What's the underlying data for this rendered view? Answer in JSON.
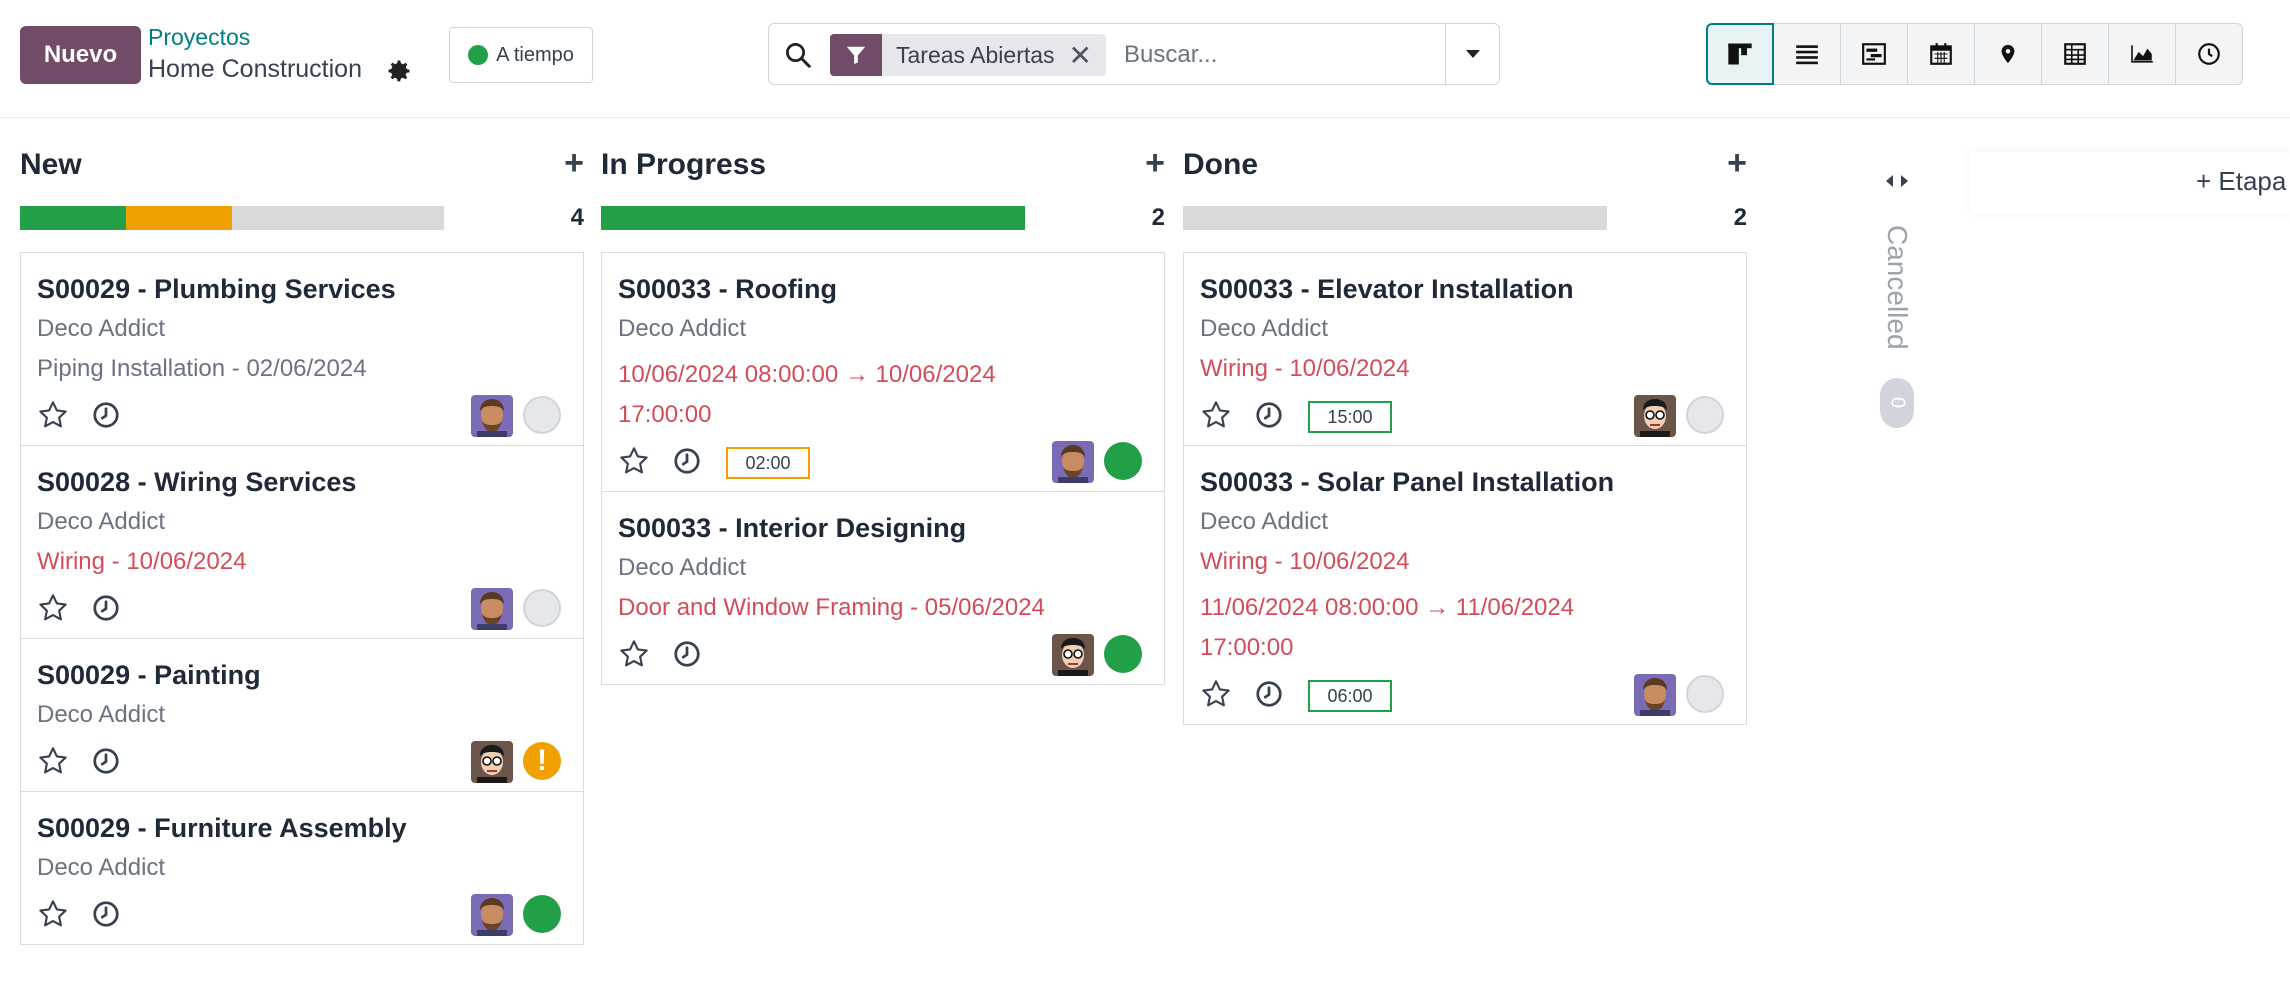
{
  "header": {
    "new_button": "Nuevo",
    "breadcrumb_link": "Proyectos",
    "project_name": "Home Construction",
    "status_label": "A tiempo"
  },
  "search": {
    "facet_label": "Tareas Abiertas",
    "placeholder": "Buscar..."
  },
  "views": [
    "kanban-icon",
    "list-icon",
    "gantt-icon",
    "calendar-icon",
    "map-icon",
    "pivot-icon",
    "graph-icon",
    "activity-icon"
  ],
  "columns": [
    {
      "name": "New",
      "count": "4",
      "progress": {
        "green": 0.25,
        "orange": 0.25
      },
      "cards": [
        {
          "title": "S00029 - Plumbing Services",
          "customer": "Deco Addict",
          "lines": [
            {
              "text": "Piping Installation - 02/06/2024",
              "red": false
            }
          ],
          "time": "",
          "avatar": "man",
          "state": "grey"
        },
        {
          "title": "S00028 - Wiring Services",
          "customer": "Deco Addict",
          "lines": [
            {
              "text": "Wiring - 10/06/2024",
              "red": true
            }
          ],
          "time": "",
          "avatar": "man",
          "state": "grey"
        },
        {
          "title": "S00029 - Painting",
          "customer": "Deco Addict",
          "lines": [],
          "time": "",
          "avatar": "glasses",
          "state": "orange"
        },
        {
          "title": "S00029 - Furniture Assembly",
          "customer": "Deco Addict",
          "lines": [],
          "time": "",
          "avatar": "man",
          "state": "green"
        }
      ]
    },
    {
      "name": "In Progress",
      "count": "2",
      "progress": {
        "green": 1.0,
        "orange": 0
      },
      "cards": [
        {
          "title": "S00033 - Roofing",
          "customer": "Deco Addict",
          "lines": [
            {
              "text": "10/06/2024 08:00:00 → 10/06/2024",
              "red": true
            },
            {
              "text": "17:00:00",
              "red": true
            }
          ],
          "time": "02:00",
          "time_color": "orange",
          "avatar": "man",
          "state": "green"
        },
        {
          "title": "S00033 - Interior Designing",
          "customer": "Deco Addict",
          "lines": [
            {
              "text": "Door and Window Framing - 05/06/2024",
              "red": true
            }
          ],
          "time": "",
          "avatar": "glasses",
          "state": "green"
        }
      ]
    },
    {
      "name": "Done",
      "count": "2",
      "progress": {
        "green": 0,
        "orange": 0
      },
      "cards": [
        {
          "title": "S00033 - Elevator Installation",
          "customer": "Deco Addict",
          "lines": [
            {
              "text": "Wiring - 10/06/2024",
              "red": true
            }
          ],
          "time": "15:00",
          "time_color": "green",
          "avatar": "glasses",
          "state": "grey"
        },
        {
          "title": "S00033 - Solar Panel Installation",
          "customer": "Deco Addict",
          "lines": [
            {
              "text": "Wiring - 10/06/2024",
              "red": true
            },
            {
              "text": "11/06/2024 08:00:00 → 11/06/2024",
              "red": true
            },
            {
              "text": "17:00:00",
              "red": true
            }
          ],
          "time": "06:00",
          "time_color": "green",
          "avatar": "man",
          "state": "grey"
        }
      ]
    }
  ],
  "folded_column": {
    "name": "Cancelled",
    "count": "0"
  },
  "add_stage_label": "+ Etapa"
}
